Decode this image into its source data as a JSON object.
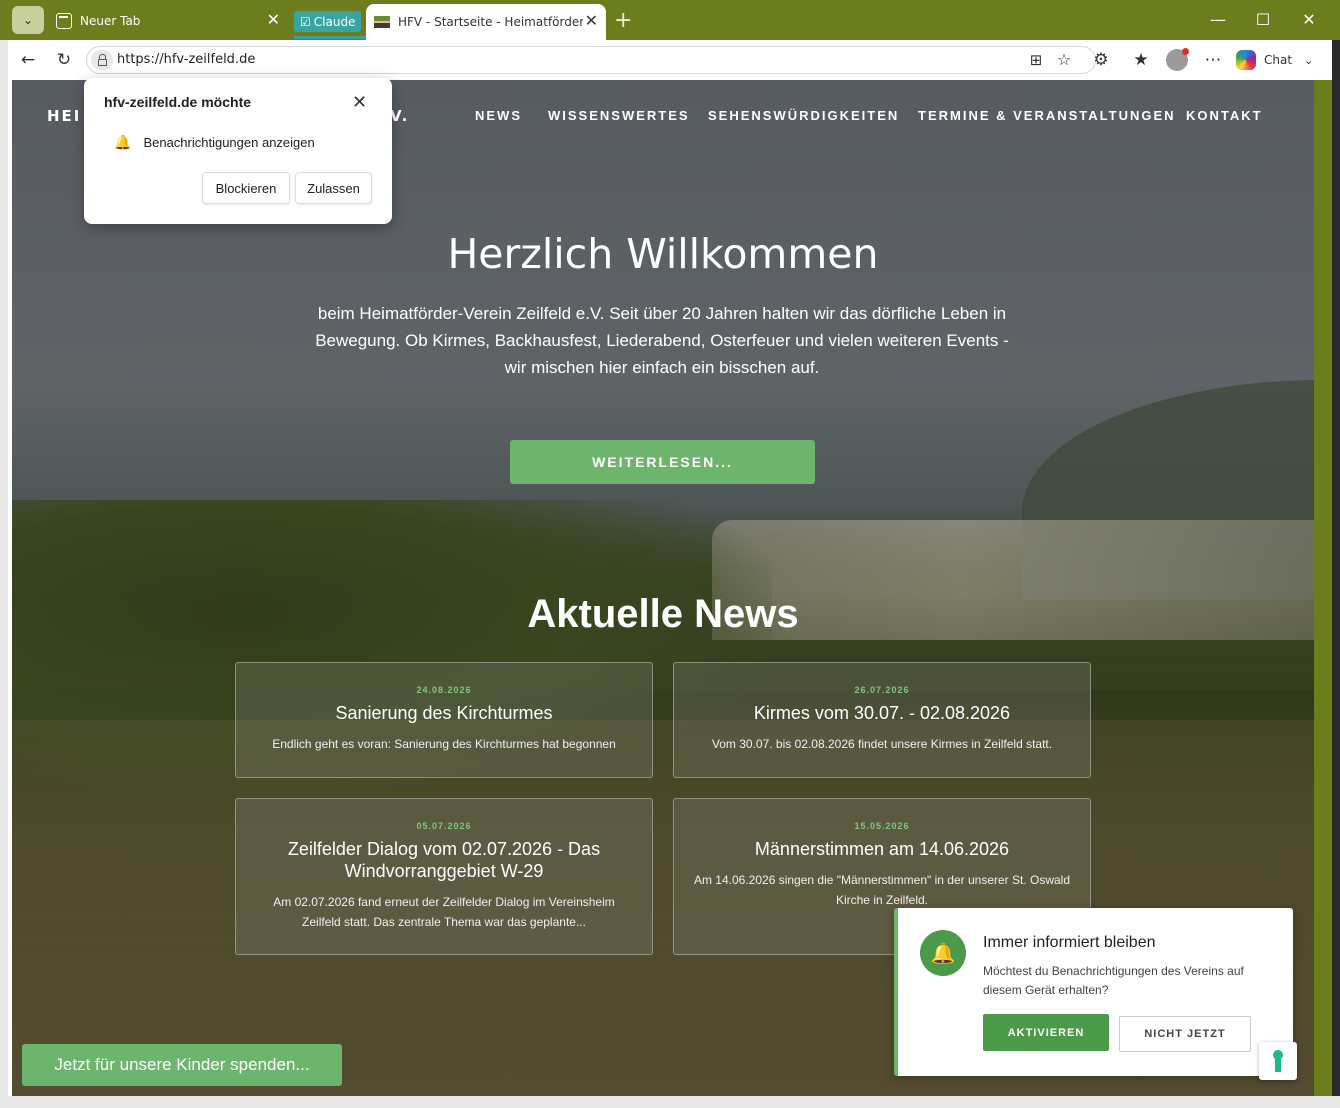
{
  "browser": {
    "tabs": [
      {
        "label": "Neuer Tab"
      },
      {
        "label": "HFV - Startseite - Heimatförder-Verein"
      }
    ],
    "tab_group_label": "Claude",
    "url": "https://hfv-zeilfeld.de",
    "chat_label": "Chat",
    "accent_color": "#6b7d1c"
  },
  "permission_popup": {
    "title": "hfv-zeilfeld.de möchte",
    "permission": "Benachrichtigungen anzeigen",
    "block_label": "Blockieren",
    "allow_label": "Zulassen"
  },
  "site": {
    "logo_left": "HEI",
    "logo_right": "V.",
    "nav": [
      "NEWS",
      "WISSENSWERTES",
      "SEHENSWÜRDIGKEITEN",
      "TERMINE & VERANSTALTUNGEN",
      "KONTAKT"
    ],
    "hero_title": "Herzlich Willkommen",
    "hero_text": "beim Heimatförder-Verein Zeilfeld e.V. Seit über 20 Jahren halten wir das dörfliche Leben in Bewegung. Ob Kirmes, Backhausfest, Liederabend, Osterfeuer und vielen weiteren Events - wir mischen hier einfach ein bisschen auf.",
    "cta_label": "WEITERLESEN...",
    "news_heading": "Aktuelle News",
    "news": [
      {
        "date": "24.08.2026",
        "title": "Sanierung des Kirchturmes",
        "desc": "Endlich geht es voran: Sanierung des Kirchturmes hat begonnen"
      },
      {
        "date": "26.07.2026",
        "title": "Kirmes vom 30.07. - 02.08.2026",
        "desc": "Vom 30.07. bis 02.08.2026 findet unsere Kirmes in Zeilfeld statt."
      },
      {
        "date": "05.07.2026",
        "title": "Zeilfelder Dialog vom 02.07.2026 - Das Windvorranggebiet W-29",
        "desc": "Am 02.07.2026 fand erneut der Zeilfelder Dialog im Vereinsheim Zeilfeld statt. Das zentrale Thema war das geplante..."
      },
      {
        "date": "15.05.2026",
        "title": "Männerstimmen am 14.06.2026",
        "desc": "Am 14.06.2026 singen die \"Männerstimmen\" in der unserer St. Oswald Kirche in Zeilfeld."
      }
    ],
    "donate_label": "Jetzt für unsere Kinder spenden...",
    "brand_green": "#6db56d"
  },
  "notification_card": {
    "title": "Immer informiert bleiben",
    "text": "Möchtest du Benachrichtigungen des Vereins auf diesem Gerät erhalten?",
    "activate_label": "AKTIVIEREN",
    "later_label": "NICHT JETZT"
  }
}
